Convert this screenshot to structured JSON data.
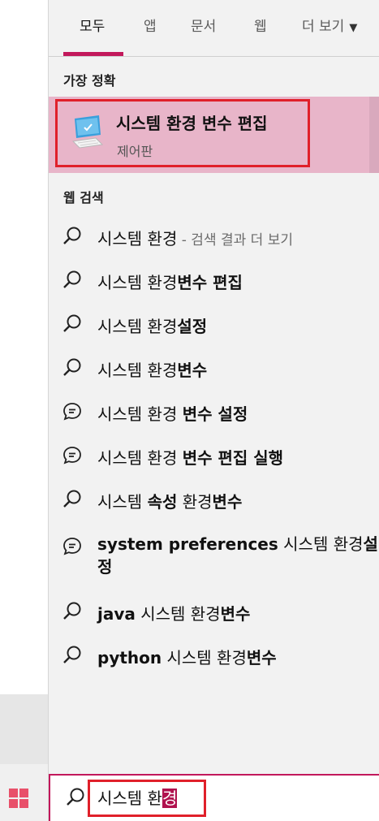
{
  "tabs": [
    {
      "label": "모두",
      "active": true
    },
    {
      "label": "앱",
      "active": false
    },
    {
      "label": "문서",
      "active": false
    },
    {
      "label": "웹",
      "active": false
    },
    {
      "label": "더 보기",
      "active": false
    }
  ],
  "best_match": {
    "section_label": "가장 정확",
    "title": "시스템 환경 변수 편집",
    "subtitle": "제어판",
    "icon": "computer-monitor-icon"
  },
  "web_search": {
    "section_label": "웹 검색",
    "items": [
      {
        "prefix": "시스템 환경",
        "bold": "",
        "hint": " - 검색 결과 더 보기",
        "icon": "search-icon"
      },
      {
        "prefix": "시스템 환경",
        "bold": "변수 편집",
        "hint": "",
        "icon": "search-icon"
      },
      {
        "prefix": "시스템 환경",
        "bold": "설정",
        "hint": "",
        "icon": "search-icon"
      },
      {
        "prefix": "시스템 환경",
        "bold": "변수",
        "hint": "",
        "icon": "search-icon"
      },
      {
        "prefix": "시스템 환경 ",
        "bold": "변수 설정",
        "hint": "",
        "icon": "chat-bubble-icon"
      },
      {
        "prefix": "시스템 환경 ",
        "bold": "변수 편집 실행",
        "hint": "",
        "icon": "chat-bubble-icon"
      },
      {
        "prefix": "시스템 ",
        "bold": "속성",
        "mid": " 환경",
        "bold2": "변수",
        "icon": "search-icon"
      },
      {
        "bold": "system preferences",
        "mid": " 시스템 환경",
        "bold2": "설정",
        "icon": "chat-bubble-icon"
      },
      {
        "bold": "java",
        "mid": " 시스템 환경",
        "bold2": "변수",
        "icon": "search-icon"
      },
      {
        "bold": "python",
        "mid": " 시스템 환경",
        "bold2": "변수",
        "icon": "search-icon"
      }
    ]
  },
  "search": {
    "query_prefix": "시스템 환",
    "query_selected": "경"
  },
  "colors": {
    "accent": "#c2185b",
    "highlight_bg": "#e8b5c9",
    "annotation_red": "#e0202a"
  }
}
